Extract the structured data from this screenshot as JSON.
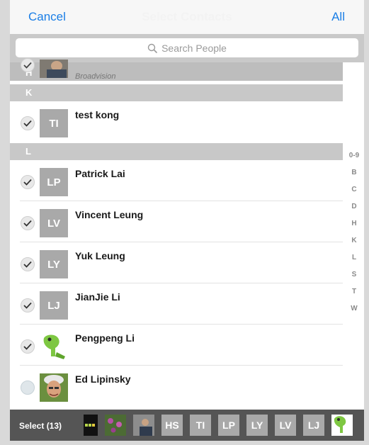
{
  "navbar": {
    "cancel_label": "Cancel",
    "title": "Select Contacts",
    "all_label": "All"
  },
  "search": {
    "placeholder": "Search People"
  },
  "partial_row": {
    "section_letter": "H",
    "company": "Broadvision",
    "selected": true
  },
  "sections": [
    {
      "letter": "K",
      "contacts": [
        {
          "name": "test kong",
          "initials": "TI",
          "selected": true,
          "avatar": "initials"
        }
      ]
    },
    {
      "letter": "L",
      "contacts": [
        {
          "name": "Patrick Lai",
          "initials": "LP",
          "selected": true,
          "avatar": "initials"
        },
        {
          "name": "Vincent Leung",
          "initials": "LV",
          "selected": true,
          "avatar": "initials"
        },
        {
          "name": "Yuk Leung",
          "initials": "LY",
          "selected": true,
          "avatar": "initials"
        },
        {
          "name": "JianJie Li",
          "initials": "LJ",
          "selected": true,
          "avatar": "initials"
        },
        {
          "name": "Pengpeng Li",
          "initials": "",
          "selected": true,
          "avatar": "green-creature-photo"
        },
        {
          "name": "Ed Lipinsky",
          "initials": "",
          "selected": false,
          "avatar": "person-photo"
        }
      ]
    }
  ],
  "index": [
    "0-9",
    "B",
    "C",
    "D",
    "H",
    "K",
    "L",
    "S",
    "T",
    "W"
  ],
  "toolbar": {
    "select_label": "Select (13)",
    "chips": [
      {
        "type": "photo",
        "icon": "battery-photo"
      },
      {
        "type": "photo",
        "icon": "flowers-photo"
      },
      {
        "type": "photo",
        "icon": "person-photo"
      },
      {
        "type": "initials",
        "label": "HS"
      },
      {
        "type": "initials",
        "label": "TI"
      },
      {
        "type": "initials",
        "label": "LP"
      },
      {
        "type": "initials",
        "label": "LY"
      },
      {
        "type": "initials",
        "label": "LV"
      },
      {
        "type": "initials",
        "label": "LJ"
      },
      {
        "type": "photo",
        "icon": "green-creature-photo"
      }
    ]
  },
  "colors": {
    "accent": "#1a7ee6",
    "section_header": "#c8c8c8",
    "avatar_bg": "#a9a9a9",
    "toolbar_bg": "#555555"
  }
}
